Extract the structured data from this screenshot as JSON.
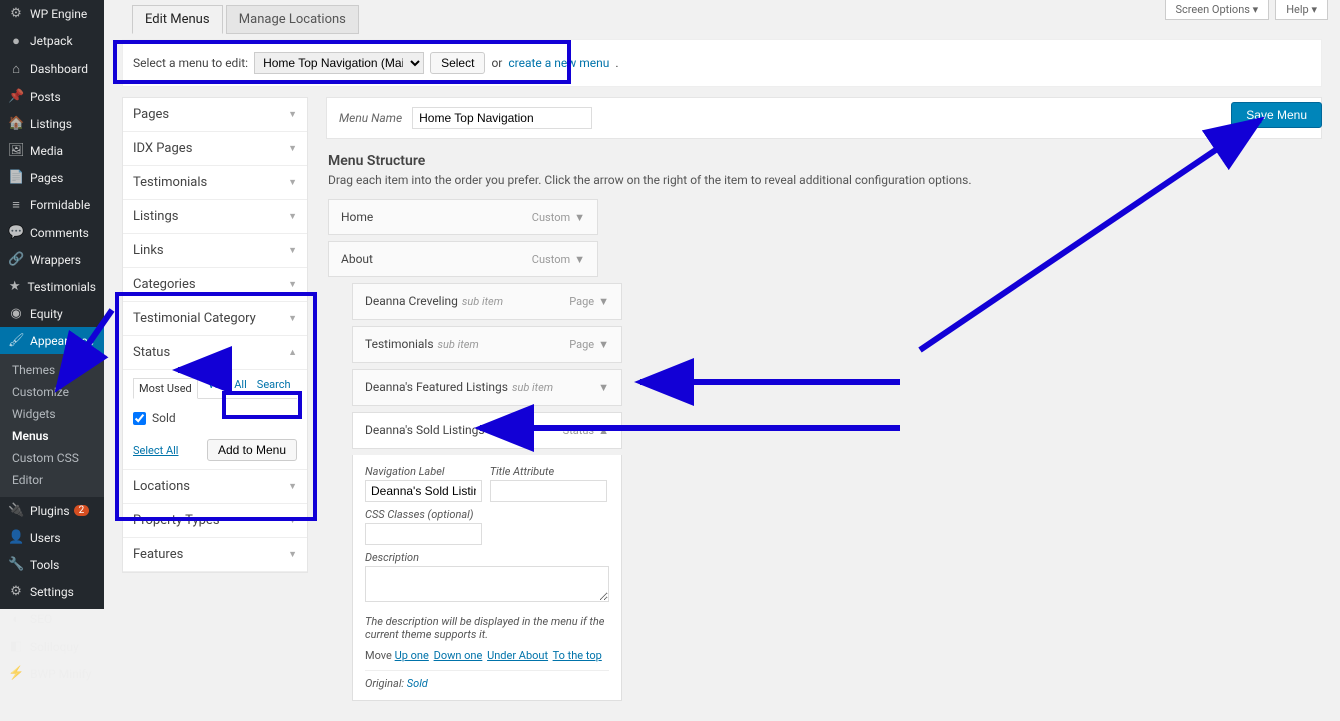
{
  "screen_options": {
    "label": "Screen Options",
    "help": "Help"
  },
  "sidebar": {
    "items": [
      {
        "label": "WP Engine",
        "icon": "⚙"
      },
      {
        "label": "Jetpack",
        "icon": "●"
      },
      {
        "label": "Dashboard",
        "icon": "⌂"
      },
      {
        "label": "Posts",
        "icon": "📌"
      },
      {
        "label": "Listings",
        "icon": "🏠"
      },
      {
        "label": "Media",
        "icon": "🖼"
      },
      {
        "label": "Pages",
        "icon": "📄"
      },
      {
        "label": "Formidable",
        "icon": "≡"
      },
      {
        "label": "Comments",
        "icon": "💬"
      },
      {
        "label": "Wrappers",
        "icon": "🔗"
      },
      {
        "label": "Testimonials",
        "icon": "★"
      },
      {
        "label": "Equity",
        "icon": "◉"
      },
      {
        "label": "Appearance",
        "icon": "🖌",
        "active": true
      },
      {
        "label": "Plugins",
        "icon": "🔌",
        "badge": "2"
      },
      {
        "label": "Users",
        "icon": "👤"
      },
      {
        "label": "Tools",
        "icon": "🔧"
      },
      {
        "label": "Settings",
        "icon": "⚙"
      },
      {
        "label": "SEO",
        "icon": "◐"
      },
      {
        "label": "Soliloquy",
        "icon": "◧"
      },
      {
        "label": "BWP Minify",
        "icon": "⚡"
      }
    ],
    "submenu": [
      "Themes",
      "Customize",
      "Widgets",
      "Menus",
      "Custom CSS",
      "Editor"
    ],
    "submenu_current": "Menus"
  },
  "tabs": {
    "edit": "Edit Menus",
    "manage": "Manage Locations"
  },
  "select_bar": {
    "label": "Select a menu to edit:",
    "selected": "Home Top Navigation (Main Menu)",
    "select_btn": "Select",
    "or": "or",
    "create_link": "create a new menu"
  },
  "accordion": {
    "sections": [
      "Pages",
      "IDX Pages",
      "Testimonials",
      "Listings",
      "Links",
      "Categories",
      "Testimonial Category",
      "Status",
      "Locations",
      "Property Types",
      "Features"
    ],
    "status": {
      "tabs": [
        "Most Used",
        "View All",
        "Search"
      ],
      "option": "Sold",
      "select_all": "Select All",
      "add_btn": "Add to Menu"
    }
  },
  "menu": {
    "name_label": "Menu Name",
    "name_value": "Home Top Navigation",
    "save_btn": "Save Menu",
    "structure_title": "Menu Structure",
    "structure_desc": "Drag each item into the order you prefer. Click the arrow on the right of the item to reveal additional configuration options.",
    "items": [
      {
        "title": "Home",
        "type": "Custom",
        "indent": false
      },
      {
        "title": "About",
        "type": "Custom",
        "indent": false
      },
      {
        "title": "Deanna Creveling",
        "sub": "sub item",
        "type": "Page",
        "indent": true
      },
      {
        "title": "Testimonials",
        "sub": "sub item",
        "type": "Page",
        "indent": true
      },
      {
        "title": "Deanna's Featured Listings",
        "sub": "sub item",
        "type": "",
        "indent": true
      },
      {
        "title": "Deanna's Sold Listings",
        "sub": "sub item",
        "type": "Status",
        "indent": true,
        "open": true
      }
    ],
    "settings": {
      "nav_label": "Navigation Label",
      "nav_value": "Deanna's Sold Listings",
      "title_attr": "Title Attribute",
      "css_label": "CSS Classes (optional)",
      "desc_label": "Description",
      "desc_help": "The description will be displayed in the menu if the current theme supports it.",
      "move_label": "Move",
      "move_links": [
        "Up one",
        "Down one",
        "Under About",
        "To the top"
      ],
      "original_label": "Original:",
      "original_value": "Sold"
    }
  }
}
